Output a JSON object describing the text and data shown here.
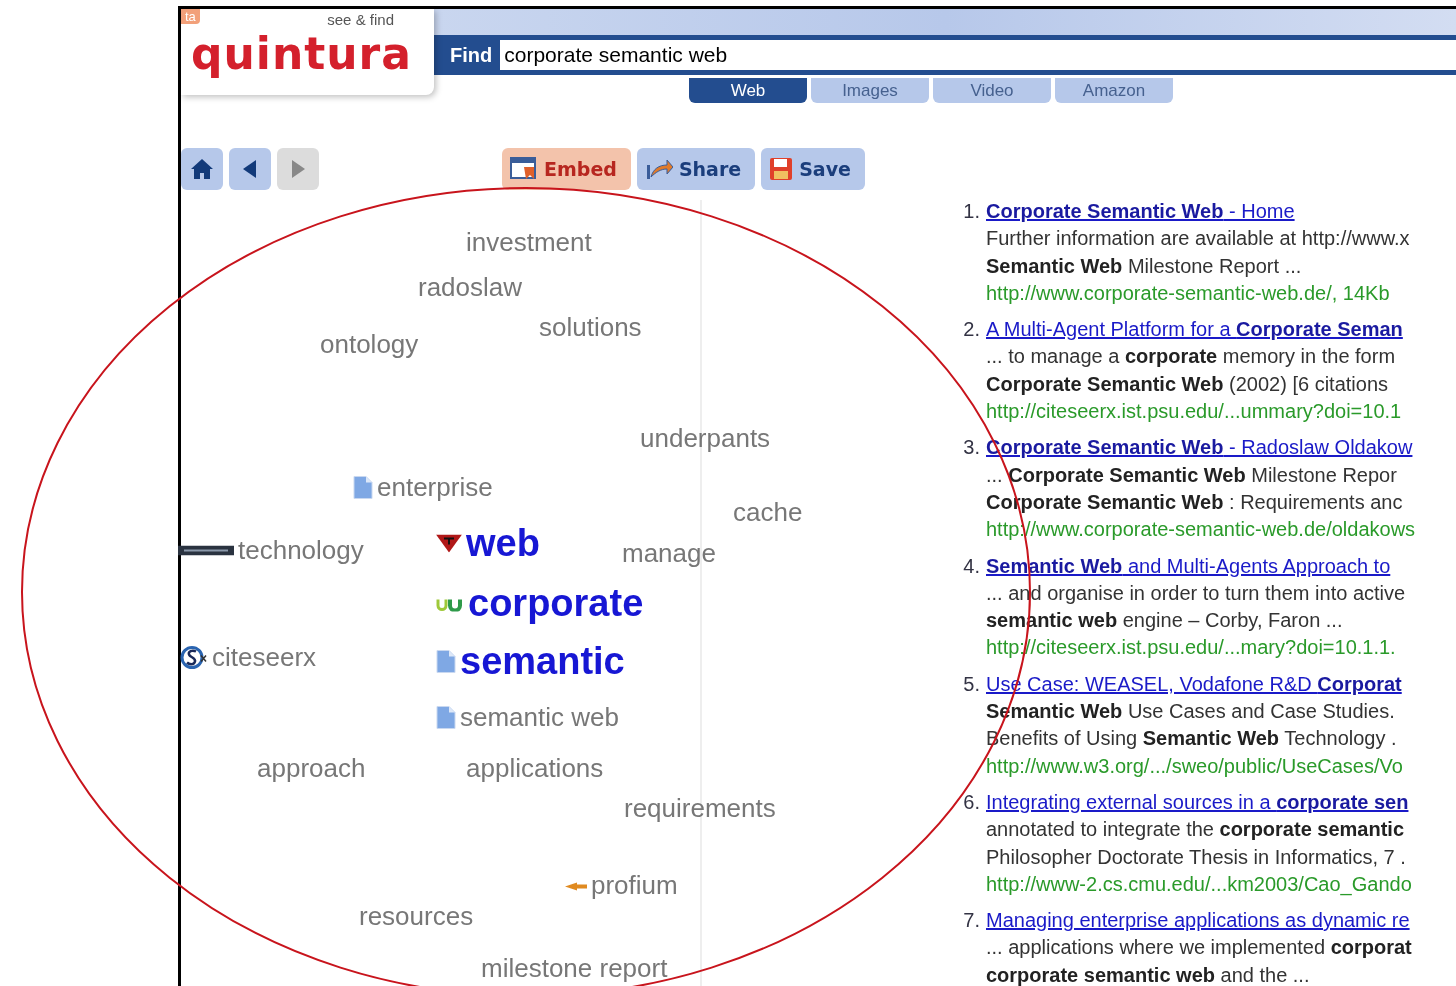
{
  "badge": "ta",
  "logo": {
    "name": "quintura",
    "tagline": "see & find"
  },
  "search": {
    "label": "Find",
    "value": "corporate semantic web"
  },
  "tabs": [
    {
      "label": "Web",
      "selected": true
    },
    {
      "label": "Images",
      "selected": false
    },
    {
      "label": "Video",
      "selected": false
    },
    {
      "label": "Amazon",
      "selected": false
    }
  ],
  "nav_buttons": [
    {
      "kind": "home",
      "disabled": false
    },
    {
      "kind": "back",
      "disabled": false
    },
    {
      "kind": "forward",
      "disabled": true
    }
  ],
  "action_buttons": [
    {
      "label": "Embed",
      "kind": "embed",
      "highlighted": true
    },
    {
      "label": "Share",
      "kind": "share",
      "highlighted": false
    },
    {
      "label": "Save",
      "kind": "save",
      "highlighted": false
    }
  ],
  "cloud_words": [
    {
      "text": "investment",
      "kind": "plain"
    },
    {
      "text": "radoslaw",
      "kind": "plain"
    },
    {
      "text": "solutions",
      "kind": "plain"
    },
    {
      "text": "ontology",
      "kind": "plain"
    },
    {
      "text": "underpants",
      "kind": "plain"
    },
    {
      "text": "enterprise",
      "kind": "plain"
    },
    {
      "text": "cache",
      "kind": "plain"
    },
    {
      "text": "technology",
      "kind": "plain"
    },
    {
      "text": "web",
      "kind": "query"
    },
    {
      "text": "manage",
      "kind": "plain"
    },
    {
      "text": "corporate",
      "kind": "query"
    },
    {
      "text": "citeseerx",
      "kind": "plain"
    },
    {
      "text": "semantic",
      "kind": "query"
    },
    {
      "text": "semantic web",
      "kind": "plain"
    },
    {
      "text": "approach",
      "kind": "plain"
    },
    {
      "text": "applications",
      "kind": "plain"
    },
    {
      "text": "requirements",
      "kind": "plain"
    },
    {
      "text": "profium",
      "kind": "plain"
    },
    {
      "text": "resources",
      "kind": "plain"
    },
    {
      "text": "milestone report",
      "kind": "plain"
    }
  ],
  "results": [
    {
      "number": "1.",
      "title": "**Corporate Semantic Web** - Home",
      "snippet": [
        "Further information are available at http://www.x",
        "**Semantic Web** Milestone Report ..."
      ],
      "url": "http://www.corporate-semantic-web.de/, 14Kb"
    },
    {
      "number": "2.",
      "title": "A Multi-Agent Platform for a **Corporate Seman**",
      "snippet": [
        "... to manage a **corporate** memory in the form",
        "**Corporate Semantic Web** (2002) [6 citations"
      ],
      "url": "http://citeseerx.ist.psu.edu/...ummary?doi=10.1"
    },
    {
      "number": "3.",
      "title": "**Corporate Semantic Web** - Radoslaw Oldakow",
      "snippet": [
        "... **Corporate Semantic Web** Milestone Repor",
        "**Corporate Semantic Web** : Requirements anc"
      ],
      "url": "http://www.corporate-semantic-web.de/oldakows"
    },
    {
      "number": "4.",
      "title": "**Semantic Web** and Multi-Agents Approach to",
      "snippet": [
        "... and organise in order to turn them into active",
        "**semantic web** engine – Corby, Faron ..."
      ],
      "url": "http://citeseerx.ist.psu.edu/...mary?doi=10.1.1."
    },
    {
      "number": "5.",
      "title": "Use Case: WEASEL, Vodafone R&D **Corporat**",
      "snippet": [
        "**Semantic Web** Use Cases and Case Studies.",
        "Benefits of Using **Semantic Web** Technology ."
      ],
      "url": "http://www.w3.org/.../sweo/public/UseCases/Vo"
    },
    {
      "number": "6.",
      "title": "Integrating external sources in a **corporate sen**",
      "snippet": [
        "annotated to integrate the **corporate semantic**",
        "Philosopher Doctorate Thesis in Informatics, 7 ."
      ],
      "url": "http://www-2.cs.cmu.edu/...km2003/Cao_Gando"
    },
    {
      "number": "7.",
      "title": "Managing enterprise applications as dynamic re",
      "snippet": [
        "... applications where we implemented **corporat**",
        "**corporate semantic web** and the ..."
      ]
    }
  ]
}
